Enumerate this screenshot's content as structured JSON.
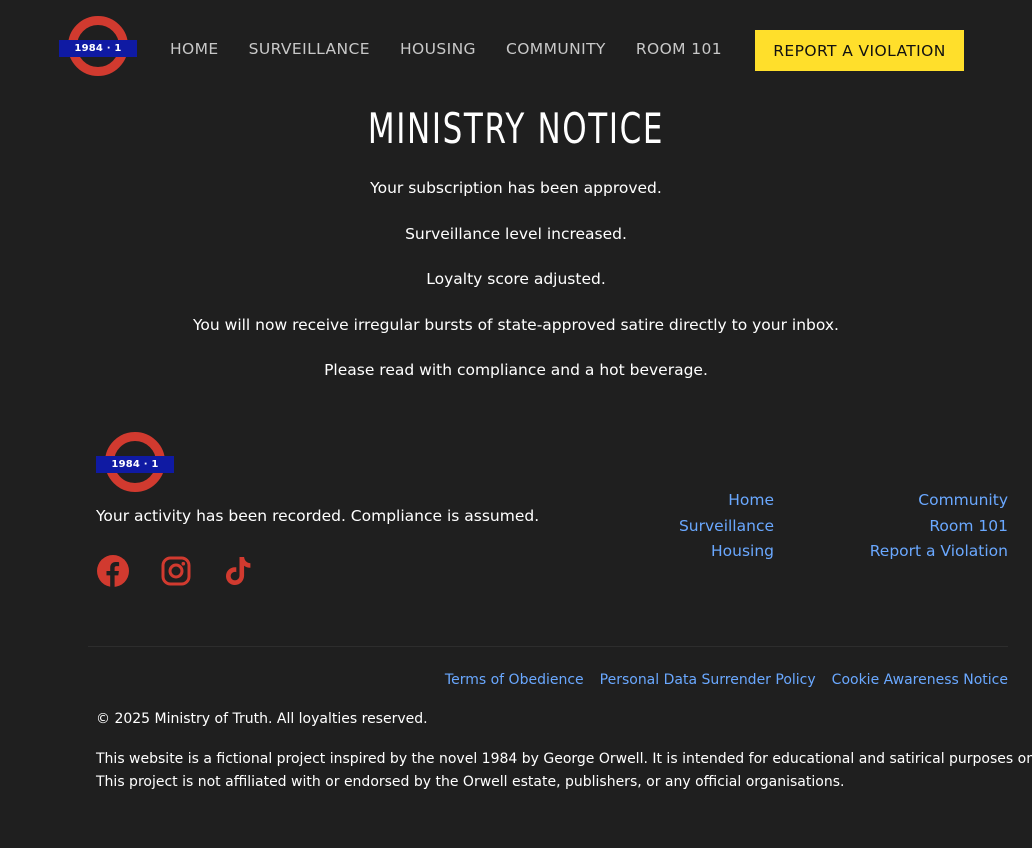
{
  "brand": {
    "logo_text": "1984 · 1",
    "ring_color": "#d13a2f",
    "bar_color": "#0f1aa3"
  },
  "nav": {
    "items": [
      {
        "label": "HOME"
      },
      {
        "label": "SURVEILLANCE"
      },
      {
        "label": "HOUSING"
      },
      {
        "label": "COMMUNITY"
      },
      {
        "label": "ROOM 101"
      }
    ],
    "report_button": "REPORT A VIOLATION",
    "report_button_color": "#ffdf2b"
  },
  "notice": {
    "title": "MINISTRY NOTICE",
    "lines": [
      "Your subscription has been approved.",
      "Surveillance level increased.",
      "Loyalty score adjusted.",
      "You will now receive irregular bursts of state-approved satire directly to your inbox.",
      "Please read with compliance and a hot beverage."
    ]
  },
  "footer": {
    "tagline": "Your activity has been recorded. Compliance is assumed.",
    "social": [
      "facebook-icon",
      "instagram-icon",
      "tiktok-icon"
    ],
    "social_color": "#d13a2f",
    "link_color": "#6aa8ff",
    "col1": [
      "Home",
      "Surveillance",
      "Housing"
    ],
    "col2": [
      "Community",
      "Room 101",
      "Report a Violation"
    ],
    "legal_links": [
      "Terms of Obedience",
      "Personal Data Surrender Policy",
      "Cookie Awareness Notice"
    ],
    "copyright": "© 2025 Ministry of Truth. All loyalties reserved.",
    "disclaimer": [
      "This website is a fictional project inspired by the novel 1984 by George Orwell. It is intended for educational and satirical purposes only.",
      "This project is not affiliated with or endorsed by the Orwell estate, publishers, or any official organisations."
    ]
  }
}
